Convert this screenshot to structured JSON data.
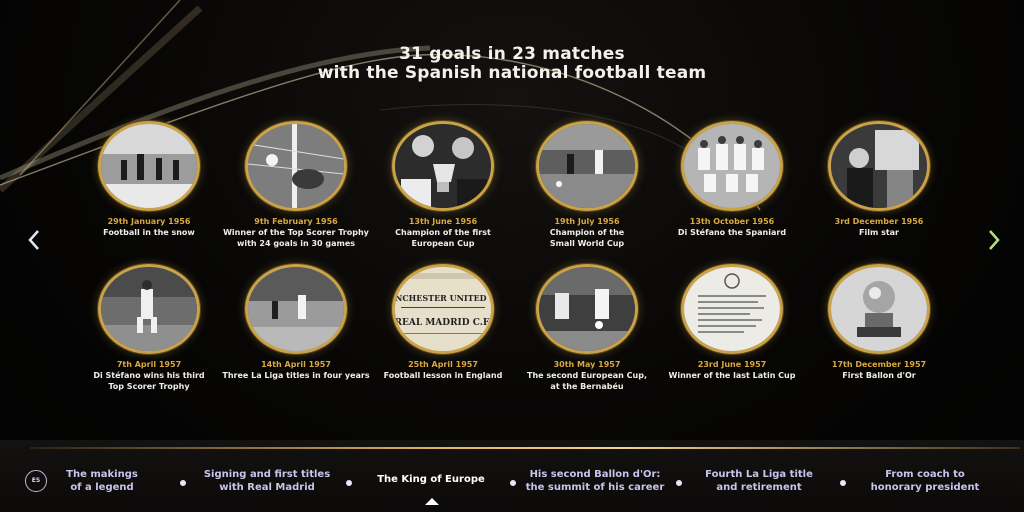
{
  "header": {
    "title_line1": "31 goals in 23 matches",
    "title_line2": "with the Spanish national football team"
  },
  "timeline": {
    "row1": [
      {
        "date": "29th January 1956",
        "caption_l1": "Football in the snow",
        "caption_l2": "",
        "icon": "snow-match-photo-icon"
      },
      {
        "date": "9th February 1956",
        "caption_l1": "Winner of the Top Scorer Trophy",
        "caption_l2": "with 24 goals in 30 games",
        "icon": "goal-post-photo-icon"
      },
      {
        "date": "13th June 1956",
        "caption_l1": "Champion of the first",
        "caption_l2": "European Cup",
        "icon": "trophy-celebration-photo-icon"
      },
      {
        "date": "19th July 1956",
        "caption_l1": "Champion of the",
        "caption_l2": "Small World Cup",
        "icon": "match-action-photo-icon"
      },
      {
        "date": "13th October 1956",
        "caption_l1": "Di Stéfano the Spaniard",
        "caption_l2": "",
        "icon": "team-photo-icon"
      },
      {
        "date": "3rd December 1956",
        "caption_l1": "Film star",
        "caption_l2": "",
        "icon": "film-scene-photo-icon"
      }
    ],
    "row2": [
      {
        "date": "7th April 1957",
        "caption_l1": "Di Stéfano wins his third",
        "caption_l2": "Top Scorer Trophy",
        "icon": "player-running-photo-icon"
      },
      {
        "date": "14th April 1957",
        "caption_l1": "Three La Liga titles in four years",
        "caption_l2": "",
        "icon": "stadium-match-photo-icon"
      },
      {
        "date": "25th April 1957",
        "caption_l1": "Football lesson in England",
        "caption_l2": "",
        "icon": "newspaper-clipping-icon"
      },
      {
        "date": "30th May 1957",
        "caption_l1": "The second European Cup,",
        "caption_l2": "at the Bernabéu",
        "icon": "player-kick-photo-icon"
      },
      {
        "date": "23rd June 1957",
        "caption_l1": "Winner of the last Latin Cup",
        "caption_l2": "",
        "icon": "document-letter-icon"
      },
      {
        "date": "17th December 1957",
        "caption_l1": "First Ballon d'Or",
        "caption_l2": "",
        "icon": "ballon-dor-trophy-icon"
      }
    ],
    "newspaper_lines": [
      "MANCHESTER UNITED F.C.",
      "REAL MADRID C.F."
    ]
  },
  "nav": {
    "language": "ES",
    "items": [
      {
        "l1": "The makings",
        "l2": "of a legend"
      },
      {
        "l1": "Signing and first titles",
        "l2": "with Real Madrid"
      },
      {
        "l1": "The King of Europe",
        "l2": ""
      },
      {
        "l1": "His second Ballon d'Or:",
        "l2": "the summit of his career"
      },
      {
        "l1": "Fourth La Liga title",
        "l2": "and retirement"
      },
      {
        "l1": "From coach to",
        "l2": "honorary president"
      }
    ],
    "active_index": 2
  },
  "colors": {
    "gold": "#c9a24a",
    "date_gold": "#d9a83f",
    "nav_text": "#c9c4ec",
    "arrow_right": "#b9e07a"
  }
}
